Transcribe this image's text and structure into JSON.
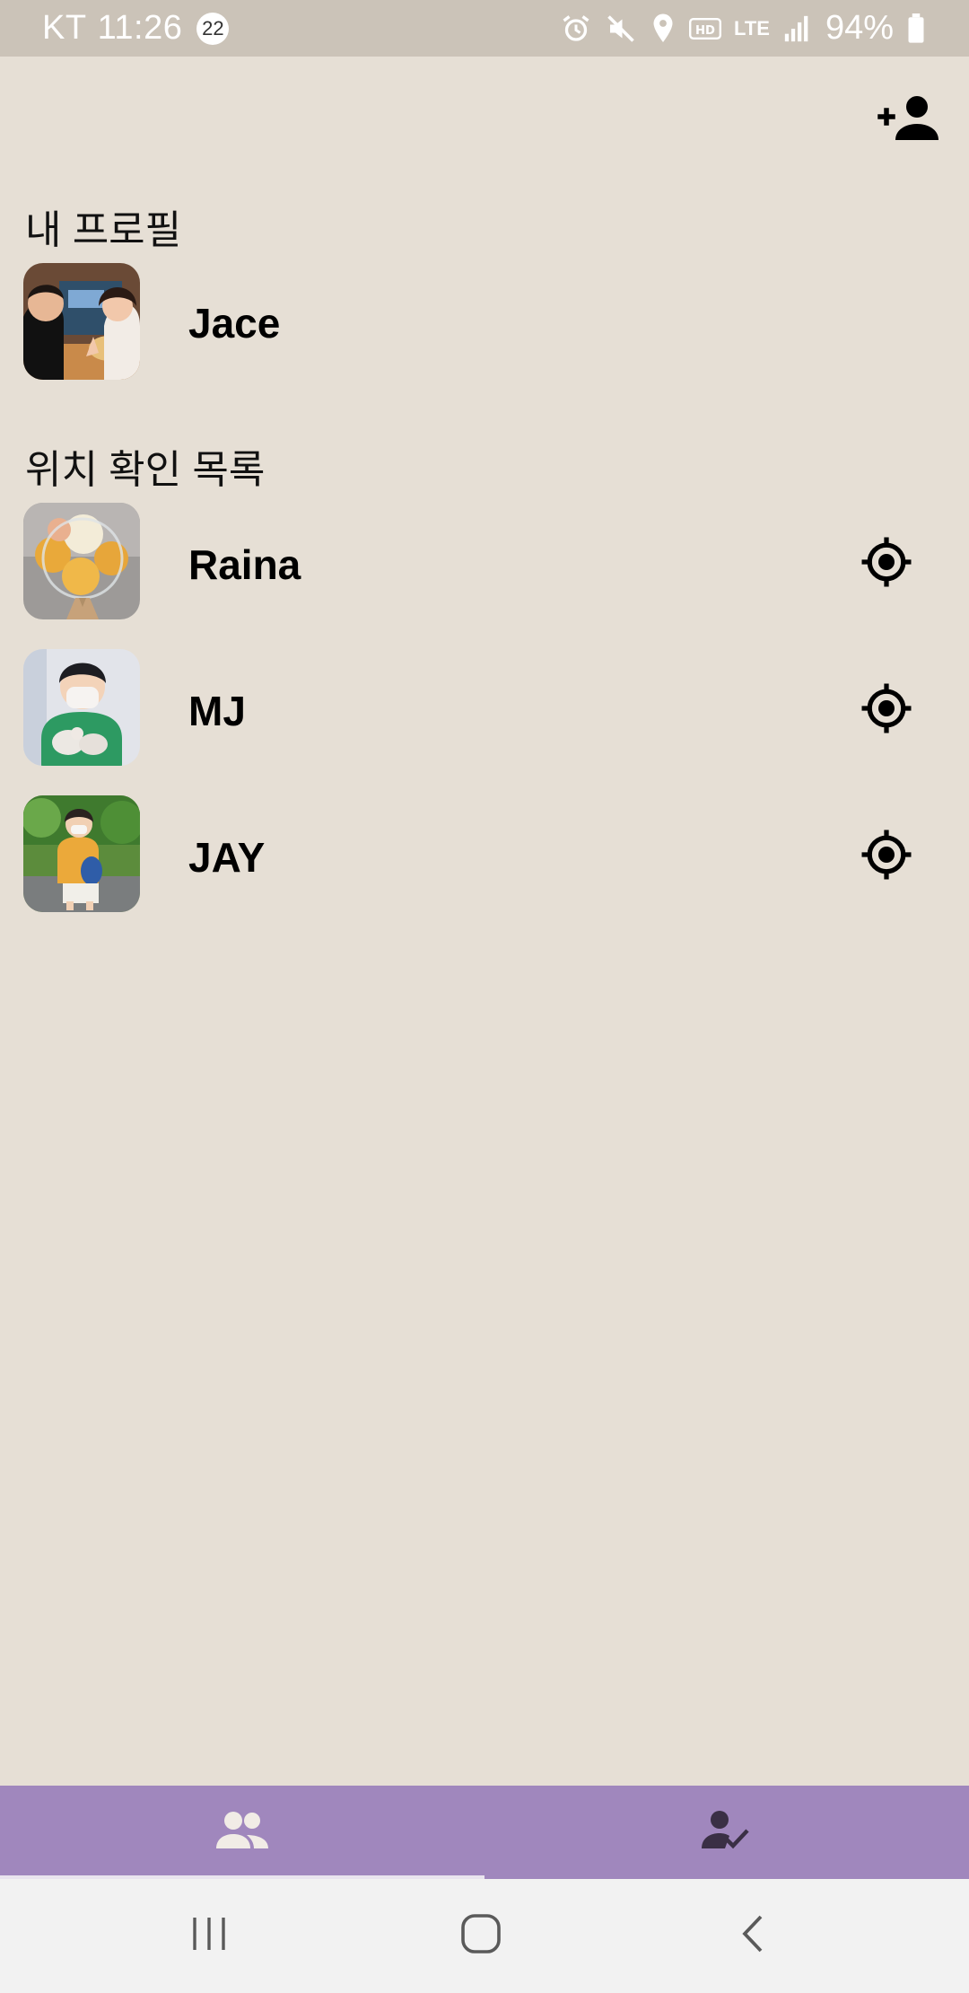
{
  "status_bar": {
    "carrier": "KT",
    "time": "11:26",
    "notification_count": "22",
    "network": "LTE",
    "battery": "94%",
    "icons": [
      "alarm-icon",
      "mute-icon",
      "location-icon",
      "hd-icon",
      "lte-icon",
      "signal-icon",
      "battery-icon"
    ]
  },
  "header": {
    "add_friend_icon": "person-add-icon"
  },
  "my_profile": {
    "section_title": "내 프로필",
    "name": "Jace"
  },
  "location_list": {
    "section_title": "위치 확인 목록",
    "items": [
      {
        "name": "Raina",
        "action_icon": "my-location-icon"
      },
      {
        "name": "MJ",
        "action_icon": "my-location-icon"
      },
      {
        "name": "JAY",
        "action_icon": "my-location-icon"
      }
    ]
  },
  "bottom_nav": {
    "tabs": [
      {
        "icon": "people-icon",
        "selected": true
      },
      {
        "icon": "person-check-icon",
        "selected": false
      }
    ]
  },
  "system_nav": [
    "recent-apps-icon",
    "home-icon",
    "back-icon"
  ],
  "colors": {
    "background": "#e6dfd5",
    "status_bar": "#cbc3b8",
    "bottom_nav": "#a087bd",
    "system_nav": "#f2f2f2"
  }
}
